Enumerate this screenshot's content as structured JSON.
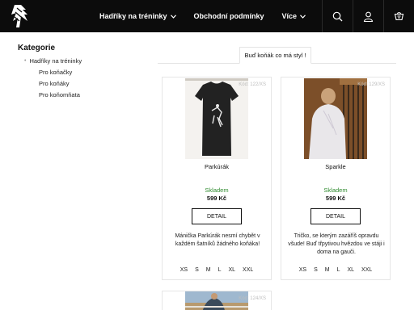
{
  "nav": {
    "items": [
      {
        "label": "Hadříky na tréninky",
        "has_dropdown": true
      },
      {
        "label": "Obchodní podmínky",
        "has_dropdown": false
      },
      {
        "label": "Více",
        "has_dropdown": true
      }
    ],
    "icons": [
      "search-icon",
      "user-icon",
      "cart-icon"
    ]
  },
  "sidebar": {
    "title": "Kategorie",
    "top_category": "Hadříky na tréninky",
    "subcategories": [
      "Pro koňačky",
      "Pro koňáky",
      "Pro koňomňata"
    ]
  },
  "filter": {
    "tab_label": "Buď koňák co má styl !"
  },
  "products": [
    {
      "code": "Kód: 122/XS",
      "name": "Parkúrák",
      "stock": "Skladem",
      "price": "599 Kč",
      "detail_label": "DETAIL",
      "description": "Mánička Parkúrák nesmí chybět v každém šatníků žádného koňáka!",
      "sizes": [
        "XS",
        "S",
        "M",
        "L",
        "XL",
        "XXL"
      ]
    },
    {
      "code": "Kód: 129/XS",
      "name": "Sparkle",
      "stock": "Skladem",
      "price": "599 Kč",
      "detail_label": "DETAIL",
      "description": "Tričko, se kterým zazáříš opravdu všude! Buď třpytivou hvězdou ve stáji i doma na gauči.",
      "sizes": [
        "XS",
        "S",
        "M",
        "L",
        "XL",
        "XXL"
      ]
    }
  ],
  "partial_product": {
    "code": "Kód: 124/XS"
  },
  "colors": {
    "topbar": "#0c0c0c",
    "stock": "#2d8a2d",
    "border": "#e6e6e6"
  }
}
